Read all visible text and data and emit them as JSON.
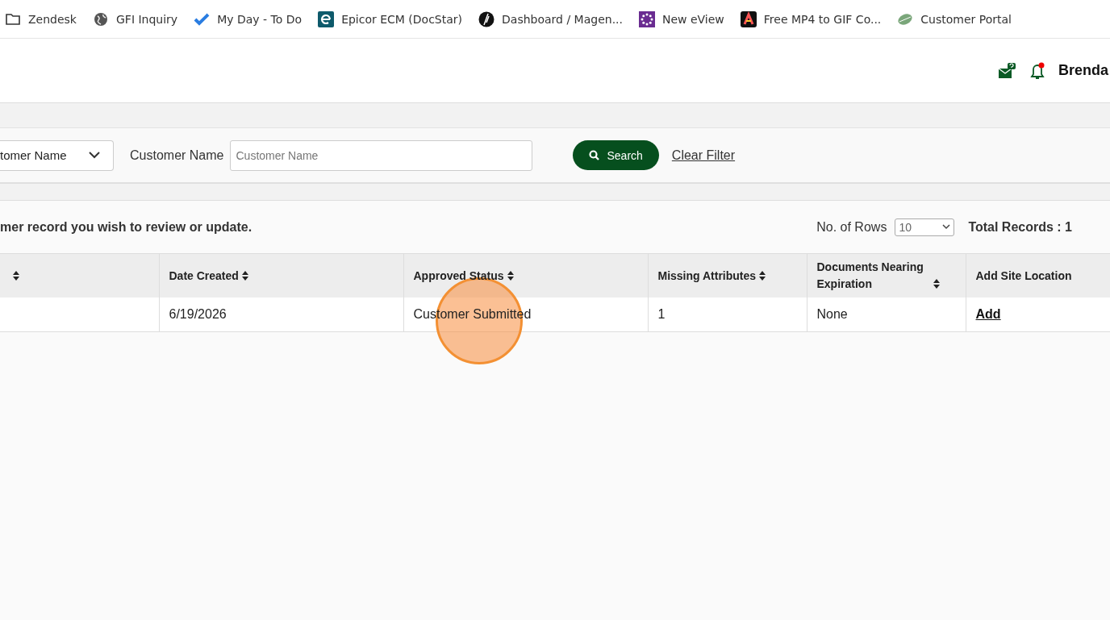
{
  "bookmarks": [
    {
      "kind": "folder",
      "label": "Zendesk"
    },
    {
      "kind": "globe",
      "label": "GFI Inquiry"
    },
    {
      "kind": "check",
      "label": "My Day - To Do"
    },
    {
      "kind": "epicor",
      "label": "Epicor ECM (DocStar)"
    },
    {
      "kind": "magento",
      "label": "Dashboard / Magen..."
    },
    {
      "kind": "eview",
      "label": "New eView"
    },
    {
      "kind": "adobe",
      "label": "Free MP4 to GIF Co..."
    },
    {
      "kind": "leaf",
      "label": "Customer Portal"
    }
  ],
  "header": {
    "user": "Brenda",
    "notification_dot": true
  },
  "filter": {
    "select_value": "tomer Name",
    "field_label": "Customer Name",
    "field_placeholder": "Customer Name",
    "search_button": "Search",
    "clear_link": "Clear Filter"
  },
  "instructions": "mer record you wish to review or update.",
  "rows_label": "No. of Rows",
  "rows_value": "10",
  "total_records": "Total Records : 1",
  "table": {
    "columns": [
      {
        "sortable": true
      },
      {
        "label": "Date Created",
        "sortable": true
      },
      {
        "label": "Approved Status",
        "sortable": true
      },
      {
        "label": "Missing Attributes",
        "sortable": true
      },
      {
        "label": "Documents Nearing Expiration",
        "sortable": true
      },
      {
        "label": "Add Site Location"
      }
    ],
    "rows": [
      {
        "cells": [
          "",
          "6/19/2026",
          "Customer Submitted",
          "1",
          "None"
        ],
        "link": "Add"
      }
    ]
  },
  "click_marker": true
}
